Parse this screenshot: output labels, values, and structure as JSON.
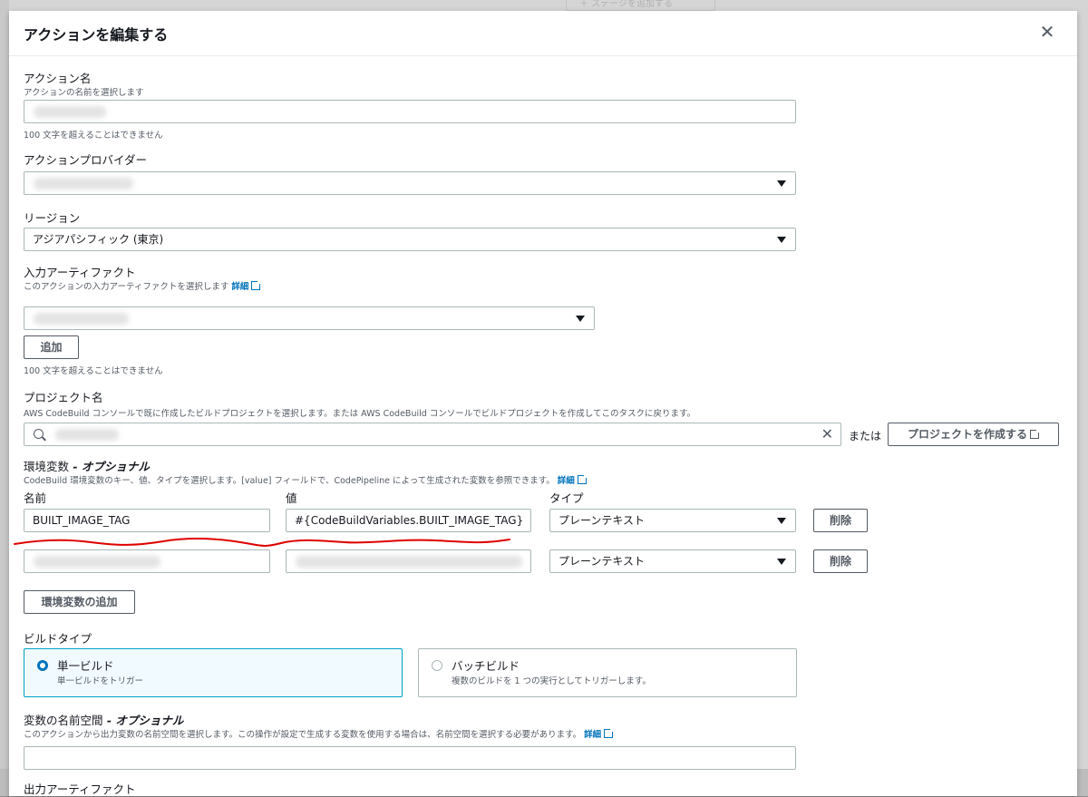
{
  "background": {
    "hint_text": "＋ ステージを追加する"
  },
  "modal": {
    "title": "アクションを編集する"
  },
  "action_name": {
    "label": "アクション名",
    "description": "アクションの名前を選択します",
    "hint": "100 文字を超えることはできません"
  },
  "action_provider": {
    "label": "アクションプロバイダー"
  },
  "region": {
    "label": "リージョン",
    "value": "アジアパシフィック (東京)"
  },
  "input_artifacts": {
    "label": "入力アーティファクト",
    "description": "このアクションの入力アーティファクトを選択します",
    "learn_more": "詳細",
    "add_button": "追加",
    "hint": "100 文字を超えることはできません"
  },
  "project_name": {
    "label": "プロジェクト名",
    "description": "AWS CodeBuild コンソールで既に作成したビルドプロジェクトを選択します。または AWS CodeBuild コンソールでビルドプロジェクトを作成してこのタスクに戻ります。",
    "or_text": "または",
    "create_button": "プロジェクトを作成する"
  },
  "env_vars": {
    "label": "環境変数",
    "label_suffix": " - オプショナル",
    "description": "CodeBuild 環境変数のキー、値、タイプを選択します。[value] フィールドで、CodePipeline によって生成された変数を参照できます。",
    "learn_more": "詳細",
    "col_name": "名前",
    "col_value": "値",
    "col_type": "タイプ",
    "rows": [
      {
        "name": "BUILT_IMAGE_TAG",
        "value": "#{CodeBuildVariables.BUILT_IMAGE_TAG}",
        "type": "プレーンテキスト",
        "delete": "削除"
      },
      {
        "name": "",
        "value": "",
        "type": "プレーンテキスト",
        "delete": "削除"
      }
    ],
    "add_button": "環境変数の追加"
  },
  "build_type": {
    "label": "ビルドタイプ",
    "options": [
      {
        "title": "単一ビルド",
        "description": "単一ビルドをトリガー",
        "selected": true
      },
      {
        "title": "バッチビルド",
        "description": "複数のビルドを 1 つの実行としてトリガーします。",
        "selected": false
      }
    ]
  },
  "variable_namespace": {
    "label": "変数の名前空間",
    "label_suffix": " - オプショナル",
    "description": "このアクションから出力変数の名前空間を選択します。この操作が設定で生成する変数を使用する場合は、名前空間を選択する必要があります。",
    "learn_more": "詳細"
  },
  "output_artifacts": {
    "label": "出力アーティファクト"
  },
  "colors": {
    "accent": "#0073bb",
    "selected_tile": "#f1faff",
    "annotation": "#e00000"
  }
}
